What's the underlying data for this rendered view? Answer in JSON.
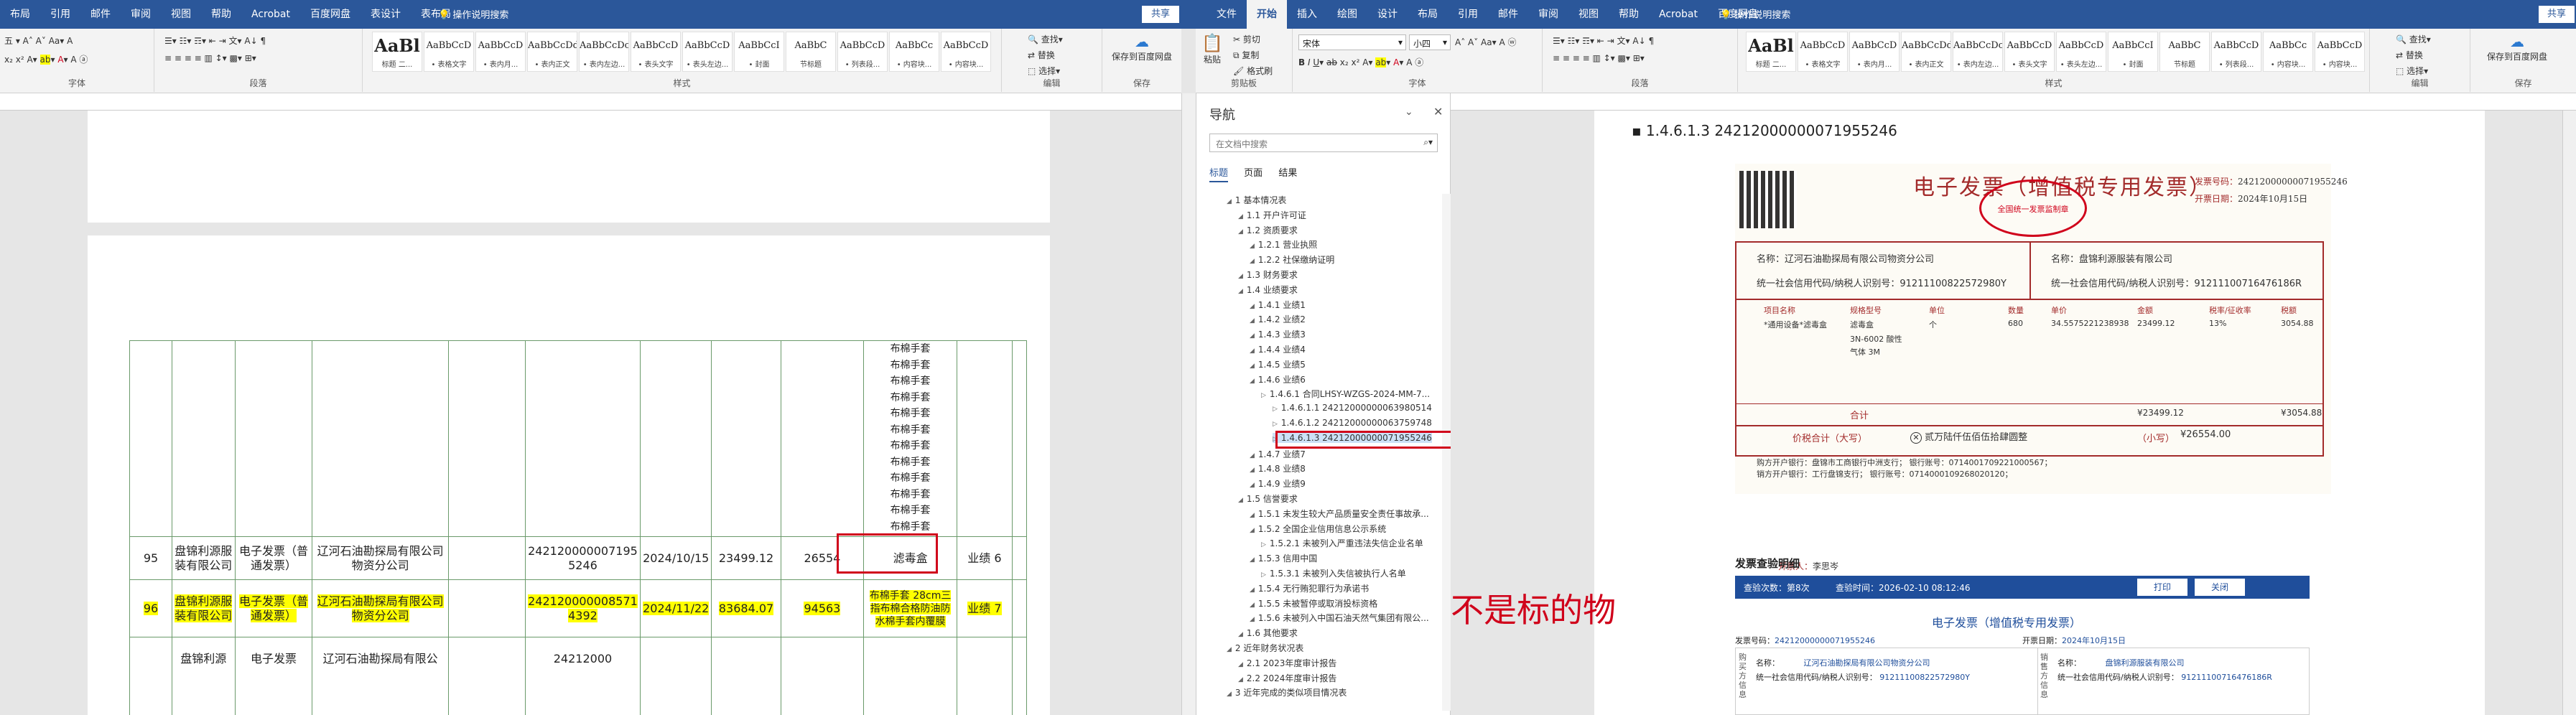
{
  "left": {
    "tabs": [
      "布局",
      "引用",
      "邮件",
      "审阅",
      "视图",
      "帮助",
      "Acrobat",
      "百度网盘",
      "表设计",
      "表布局"
    ],
    "tell_me": "操作说明搜索",
    "share": "共享",
    "groups": {
      "font": "字体",
      "paragraph": "段落",
      "styles": "样式",
      "editing": "编辑",
      "save": "保存"
    },
    "styles": [
      {
        "sample": "AaBl",
        "name": "标题 二..."
      },
      {
        "sample": "AaBbCcD",
        "name": "• 表格文字"
      },
      {
        "sample": "AaBbCcD",
        "name": "• 表内月..."
      },
      {
        "sample": "AaBbCcDd",
        "name": "• 表内正文"
      },
      {
        "sample": "AaBbCcDc",
        "name": "• 表内左边..."
      },
      {
        "sample": "AaBbCcD",
        "name": "• 表头文字"
      },
      {
        "sample": "AaBbCcD",
        "name": "• 表头左边..."
      },
      {
        "sample": "AaBbCcI",
        "name": "• 封面"
      },
      {
        "sample": "AaBbC",
        "name": "节标题"
      },
      {
        "sample": "AaBbCcD",
        "name": "• 列表段..."
      },
      {
        "sample": "AaBbCc",
        "name": "• 内容块..."
      },
      {
        "sample": "AaBbCcD",
        "name": "• 内容块..."
      }
    ],
    "edit_btns": [
      "查找",
      "替换",
      "选择"
    ],
    "save_btns": [
      "保存到百度网盘"
    ],
    "table": {
      "list_lines": [
        "布棉手套",
        "布棉手套",
        "布棉手套",
        "布棉手套",
        "布棉手套",
        "布棉手套",
        "布棉手套",
        "布棉手套",
        "布棉手套",
        "布棉手套",
        "布棉手套",
        "布棉手套"
      ],
      "row95": {
        "no": "95",
        "buyer": "盘锦利源服装有限公司",
        "type": "电子发票（普通发票）",
        "seller": "辽河石油勘探局有限公司物资分公司",
        "num": "242120000007195 5246",
        "date": "2024/10/15",
        "amount": "23499.12",
        "total": "26554",
        "goods": "滤毒盒",
        "perf": "业绩 6"
      },
      "row96": {
        "no": "96",
        "buyer": "盘锦利源服装有限公司",
        "type": "电子发票（普通发票）",
        "seller": "辽河石油勘探局有限公司物资分公司",
        "num": "242120000008571 4392",
        "date": "2024/11/22",
        "amount": "83684.07",
        "total": "94563",
        "goods": "布棉手套 28cm三指布棉合格防油防水棉手套内覆膜",
        "perf": "业绩 7"
      },
      "row97": {
        "buyer": "盘锦利源",
        "type": "电子发票",
        "seller": "辽河石油勘探局有限公",
        "num": "24212000"
      }
    }
  },
  "nav": {
    "title": "导航",
    "search_placeholder": "在文档中搜索",
    "tabs": [
      "标题",
      "页面",
      "结果"
    ],
    "items": [
      "1 基本情况表",
      "1.1 开户许可证",
      "1.2 资质要求",
      "1.2.1 营业执照",
      "1.2.2 社保缴纳证明",
      "1.3 财务要求",
      "1.4 业绩要求",
      "1.4.1 业绩1",
      "1.4.2 业绩2",
      "1.4.3 业绩3",
      "1.4.4 业绩4",
      "1.4.5 业绩5",
      "1.4.6 业绩6",
      "1.4.6.1 合同LHSY-WZGS-2024-MM-7...",
      "1.4.6.1.1 24212000000063980514",
      "1.4.6.1.2 24212000000063759748",
      "1.4.6.1.3 24212000000071955246",
      "1.4.7 业绩7",
      "1.4.8 业绩8",
      "1.4.9 业绩9",
      "1.5 信誉要求",
      "1.5.1 未发生较大产品质量安全责任事故承...",
      "1.5.2 全国企业信用信息公示系统",
      "1.5.2.1 未被列入严重违法失信企业名单",
      "1.5.3 信用中国",
      "1.5.3.1 未被列入失信被执行人名单",
      "1.5.4 无行贿犯罪行为承诺书",
      "1.5.5 未被暂停或取消投标资格",
      "1.5.6 未被列入中国石油天然气集团有限公...",
      "1.6 其他要求",
      "2 近年财务状况表",
      "2.1 2023年度审计报告",
      "2.2 2024年度审计报告",
      "3 近年完成的类似项目情况表"
    ]
  },
  "right": {
    "tabs": [
      "文件",
      "开始",
      "插入",
      "绘图",
      "设计",
      "布局",
      "引用",
      "邮件",
      "审阅",
      "视图",
      "帮助",
      "Acrobat",
      "百度网盘"
    ],
    "active_tab": "开始",
    "tell_me": "操作说明搜索",
    "share": "共享",
    "font_name": "宋体",
    "font_size": "小四",
    "clipboard": [
      "剪切",
      "复制",
      "格式刷",
      "粘贴"
    ],
    "groups": {
      "clipboard": "剪贴板",
      "font": "字体",
      "paragraph": "段落",
      "styles": "样式",
      "editing": "编辑",
      "save": "保存"
    },
    "heading": "1.4.6.1.3 24212000000071955246",
    "annotation": "不是标的物",
    "invoice": {
      "title": "电子发票（增值税专用发票）",
      "seal_text": "全国统一发票监制章",
      "no_label": "发票号码：",
      "no": "24212000000071955246",
      "date_label": "开票日期：",
      "date": "2024年10月15日",
      "buyer_name": "名称：辽河石油勘探局有限公司物资分公司",
      "buyer_tax": "统一社会信用代码/纳税人识别号：91211100822572980Y",
      "seller_name": "名称：盘锦利源服装有限公司",
      "seller_tax": "统一社会信用代码/纳税人识别号：91211100716476186R",
      "cols": [
        "项目名称",
        "规格型号",
        "单位",
        "数量",
        "单价",
        "金额",
        "税率/征收率",
        "税额"
      ],
      "item": [
        "*通用设备*滤毒盒",
        "滤毒盒",
        "个",
        "680",
        "34.5575221238938",
        "23499.12",
        "13%",
        "3054.88"
      ],
      "item_spec2": "3N-6002 酸性气体 3M",
      "total_label": "合计",
      "total_amount": "¥23499.12",
      "total_tax": "¥3054.88",
      "sum_label": "价税合计（大写）",
      "sum_words": "贰万陆仟伍佰伍拾肆圆整",
      "sum_small_label": "（小写）",
      "sum_small": "¥26554.00",
      "remark1": "购方开户银行：盘锦市工商银行中洲支行； 银行账号：0714001709221000567；",
      "remark2": "销方开户银行：工行盘锦支行； 银行账号：0714000109268020120；",
      "drawer_label": "开票人：",
      "drawer": "李思岑"
    },
    "verify": {
      "title": "发票查验明细",
      "count_label": "查验次数：",
      "count": "第8次",
      "time_label": "查验时间：",
      "time": "2026-02-10 08:12:46",
      "print": "打印",
      "close": "关闭",
      "doc_title": "电子发票（增值税专用发票）",
      "no_label": "发票号码：",
      "no": "24212000000071955246",
      "date_label": "开票日期：",
      "date": "2024年10月15日",
      "buyer_name": "辽河石油勘探局有限公司物资分公司",
      "buyer_tax": "91211100822572980Y",
      "seller_name": "盘锦利源服装有限公司",
      "seller_tax": "91211100716476186R",
      "name_label": "名称：",
      "tax_label": "统一社会信用代码/纳税人识别号：",
      "side_buyer": "购买方信息",
      "side_seller": "销售方信息"
    }
  },
  "colors": {
    "brand": "#2b579a",
    "highlight": "#ffff00",
    "red": "#d0021b",
    "invoice": "#a32b2b",
    "verify_header": "#1f4e9b"
  }
}
